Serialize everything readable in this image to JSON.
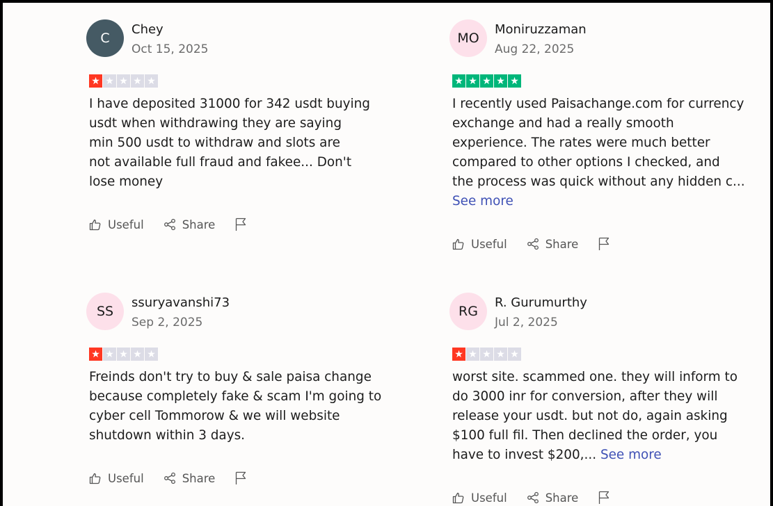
{
  "colors": {
    "star_red": "#ff3722",
    "star_green": "#00b67a",
    "star_empty": "#dcdce6",
    "link_blue": "#3f51b5",
    "avatar_dark": "#455a64",
    "avatar_pink": "#fde0ea"
  },
  "actions": {
    "useful": "Useful",
    "share": "Share"
  },
  "reviews": [
    {
      "initials": "C",
      "name": "Chey",
      "date": "Oct 15, 2025",
      "rating": 1,
      "lines": [
        "I have deposited 31000 for 342 usdt buying",
        "usdt when withdrawing they are saying",
        "min 500 usdt to withdraw and slots are",
        "not available full fraud and fakee... Don't",
        "lose money"
      ]
    },
    {
      "initials": "MO",
      "name": "Moniruzzaman",
      "date": "Aug 22, 2025",
      "rating": 5,
      "lines": [
        "I recently used Paisachange.com for currency",
        "exchange and had a really smooth",
        "experience. The rates were much better",
        "compared to other options I checked, and",
        "the process was quick without any hidden c..."
      ],
      "see_more": "See more"
    },
    {
      "initials": "SS",
      "name": "ssuryavanshi73",
      "date": "Sep 2, 2025",
      "rating": 1,
      "lines": [
        "Freinds don't try to buy & sale paisa change",
        "because completely fake & scam I'm going to",
        "cyber cell Tommorow & we will website",
        "shutdown within 3 days."
      ]
    },
    {
      "initials": "RG",
      "name": "R. Gurumurthy",
      "date": "Jul 2, 2025",
      "rating": 1,
      "lines": [
        "worst site. scammed one. they will inform to",
        "do 3000 inr for conversion, after they will",
        "release your usdt. but not do, again asking",
        "$100 full fil. Then declined the order, you",
        "have to invest $200,..."
      ],
      "see_more": "See more"
    }
  ]
}
